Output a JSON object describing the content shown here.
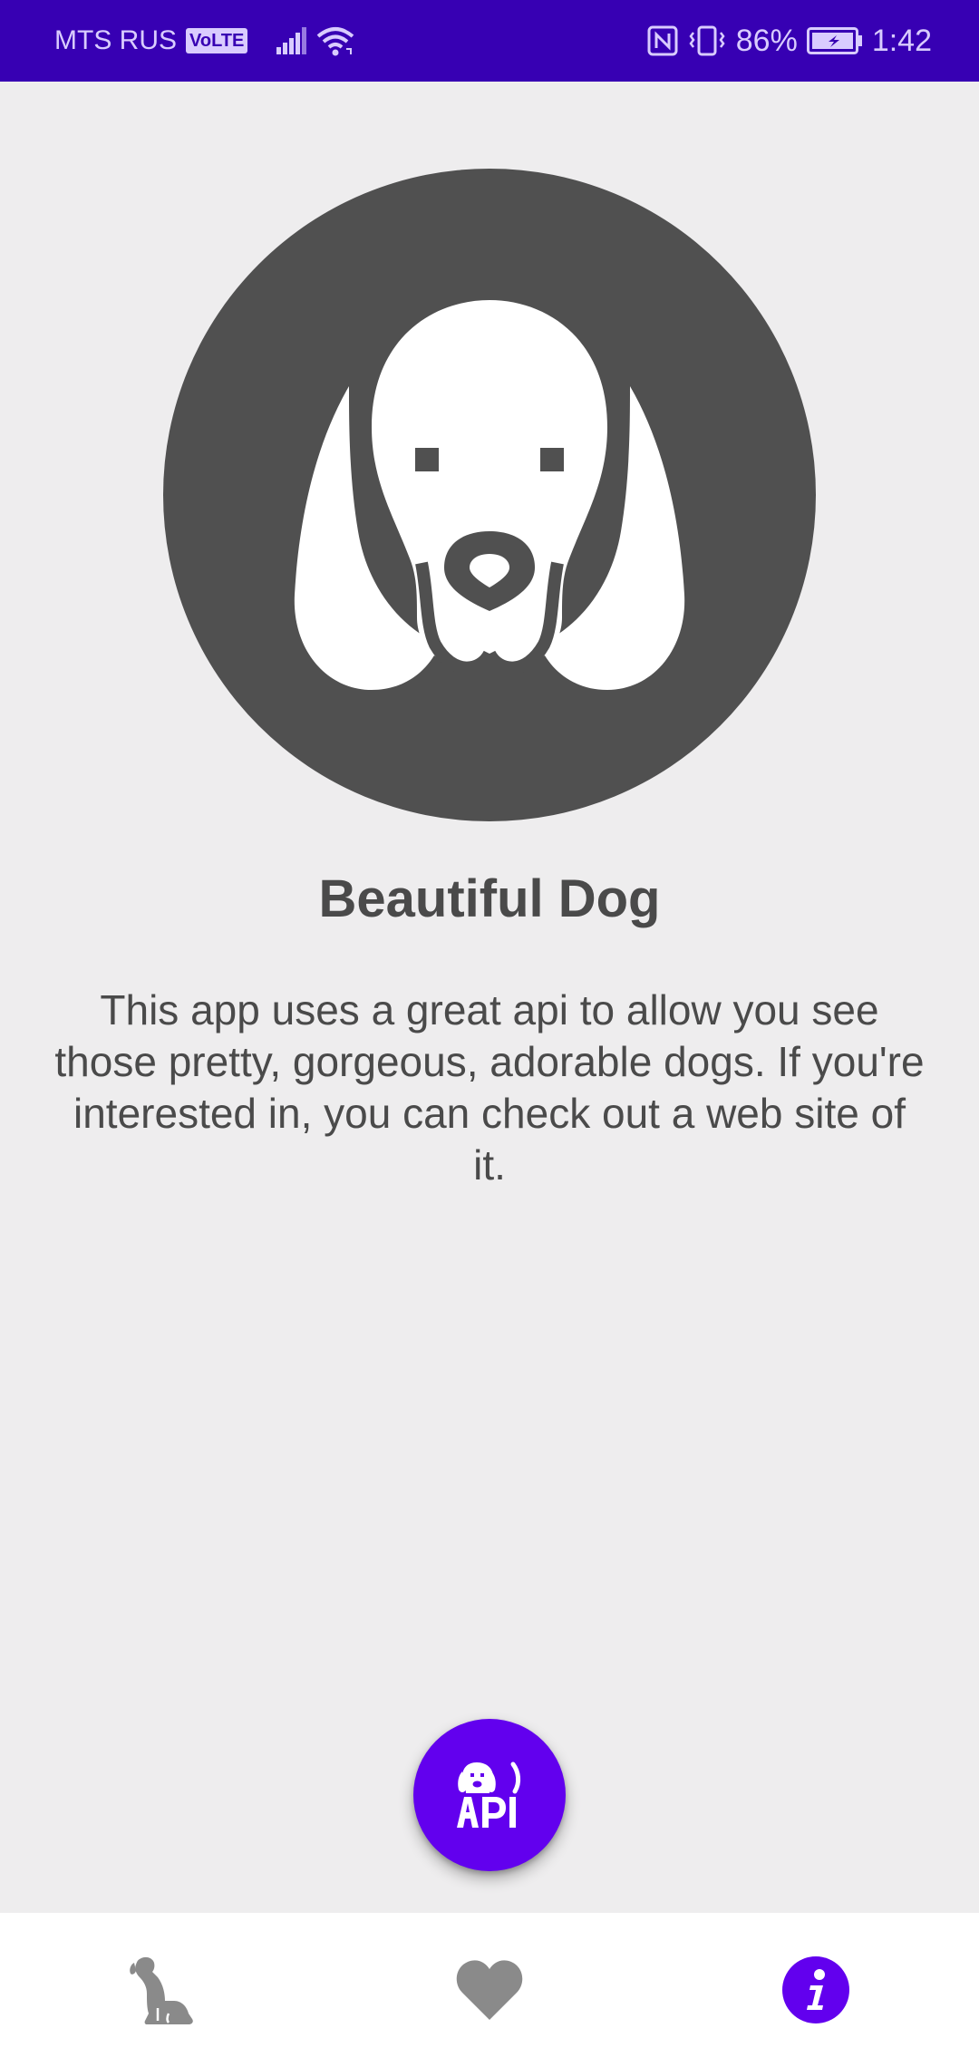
{
  "status_bar": {
    "carrier": "MTS RUS",
    "volte": "VoLTE",
    "battery": "86%",
    "time": "1:42"
  },
  "icons": {
    "signal": "signal-icon",
    "wifi": "wifi-icon",
    "nfc": "nfc-icon",
    "vibrate": "vibrate-icon",
    "battery": "battery-charging-icon",
    "dog_avatar": "dog-face-icon",
    "fab": "dog-api-icon",
    "nav_dogs": "sitting-dog-icon",
    "nav_favorites": "heart-icon",
    "nav_info": "info-icon"
  },
  "content": {
    "title": "Beautiful Dog",
    "description": "This app uses a great api to allow you see those pretty, gorgeous, adorable dogs. If you're interested in, you can check out a web site of it."
  },
  "fab": {
    "label": "API"
  },
  "colors": {
    "status_bar": "#3700b3",
    "accent": "#6200ee",
    "background": "#eeedee",
    "avatar": "#505050",
    "nav_inactive": "#8a8a8a"
  }
}
